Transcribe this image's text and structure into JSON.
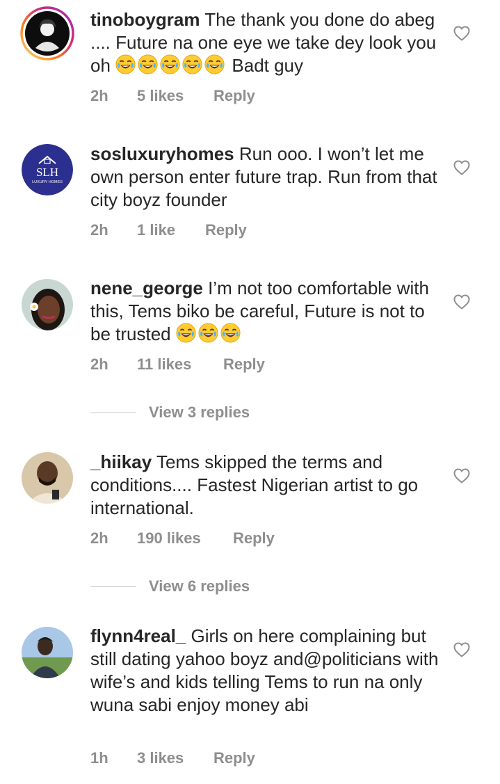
{
  "comments": [
    {
      "username": "tinoboygram",
      "text_before": "The thank you done do abeg .... Future na one eye we take dey look you oh",
      "laugh_emoji_count": 5,
      "text_after": "Badt guy",
      "time": "2h",
      "likes": "5 likes",
      "reply": "Reply",
      "avatar_icon": "profile-photo-icon"
    },
    {
      "username": "sosluxuryhomes",
      "text_before": "Run ooo. I won’t let me own person enter future trap. Run from that city boyz founder",
      "laugh_emoji_count": 0,
      "text_after": "",
      "time": "2h",
      "likes": "1 like",
      "reply": "Reply",
      "avatar_logo_top": "SLH",
      "avatar_logo_bottom": "LUXURY HOMES"
    },
    {
      "username": "nene_george",
      "text_before": "I’m not too comfortable with this, Tems biko be careful, Future is not to be trusted",
      "laugh_emoji_count": 3,
      "text_after": "",
      "time": "2h",
      "likes": "11 likes",
      "reply": "Reply",
      "view_replies": "View 3 replies"
    },
    {
      "username": "_hiikay",
      "text_before": "Tems skipped the terms and conditions.... Fastest Nigerian artist to go international.",
      "laugh_emoji_count": 0,
      "text_after": "",
      "time": "2h",
      "likes": "190 likes",
      "reply": "Reply",
      "view_replies": "View 6 replies"
    },
    {
      "username": "flynn4real_",
      "text_before": "Girls on here complaining but still dating yahoo boyz and@politicians with wife’s and kids telling Tems to run na only wuna sabi enjoy money abi",
      "laugh_emoji_count": 0,
      "text_after": "",
      "time": "1h",
      "likes": "3 likes",
      "reply": "Reply"
    }
  ],
  "colors": {
    "text": "#262626",
    "secondary": "#8e8e8e",
    "story_ring": "#d6249f",
    "brand_blue": "#2b2f8f"
  }
}
